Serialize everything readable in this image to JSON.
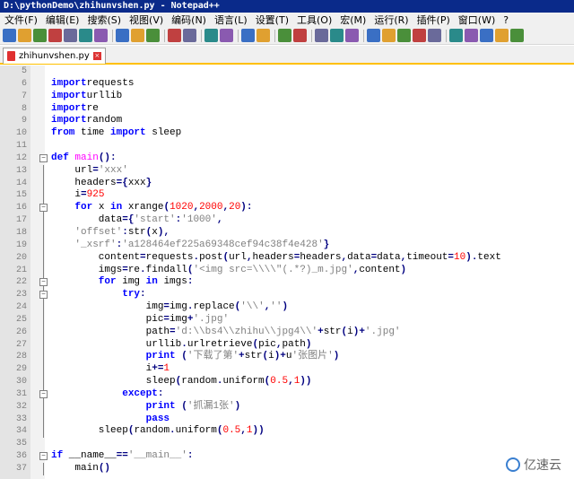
{
  "window": {
    "title": "D:\\pythonDemo\\zhihunvshen.py - Notepad++"
  },
  "menu": [
    "文件(F)",
    "编辑(E)",
    "搜索(S)",
    "视图(V)",
    "编码(N)",
    "语言(L)",
    "设置(T)",
    "工具(O)",
    "宏(M)",
    "运行(R)",
    "插件(P)",
    "窗口(W)",
    "?"
  ],
  "toolbar": {
    "icons": [
      "new-file-icon",
      "open-file-icon",
      "save-icon",
      "save-all-icon",
      "close-icon",
      "close-all-icon",
      "print-icon",
      "sep",
      "cut-icon",
      "copy-icon",
      "paste-icon",
      "sep",
      "undo-icon",
      "redo-icon",
      "sep",
      "find-icon",
      "replace-icon",
      "sep",
      "zoom-in-icon",
      "zoom-out-icon",
      "sep",
      "sync-v-icon",
      "sync-h-icon",
      "sep",
      "wrap-icon",
      "all-chars-icon",
      "indent-guide-icon",
      "sep",
      "lang-icon",
      "doc-map-icon",
      "func-list-icon",
      "folder-icon",
      "monitor-icon",
      "sep",
      "record-icon",
      "stop-icon",
      "play-icon",
      "play-multi-icon",
      "save-macro-icon"
    ]
  },
  "tab": {
    "label": "zhihunvshen.py"
  },
  "editor": {
    "lines": [
      {
        "n": "5",
        "t": []
      },
      {
        "n": "6",
        "t": [
          [
            "kw",
            "import"
          ],
          [
            "",
            "requests"
          ]
        ]
      },
      {
        "n": "7",
        "t": [
          [
            "kw",
            "import"
          ],
          [
            "",
            "urllib"
          ]
        ]
      },
      {
        "n": "8",
        "t": [
          [
            "kw",
            "import"
          ],
          [
            "",
            "re"
          ]
        ]
      },
      {
        "n": "9",
        "t": [
          [
            "kw",
            "import"
          ],
          [
            "",
            "random"
          ]
        ]
      },
      {
        "n": "10",
        "t": [
          [
            "kw",
            "from"
          ],
          [
            "",
            " time "
          ],
          [
            "kw",
            "import"
          ],
          [
            "",
            " sleep"
          ]
        ]
      },
      {
        "n": "11",
        "t": []
      },
      {
        "n": "12",
        "t": [
          [
            "kw",
            "def"
          ],
          [
            "",
            " "
          ],
          [
            "fn",
            "main"
          ],
          [
            "op",
            "():"
          ]
        ]
      },
      {
        "n": "13",
        "t": [
          [
            "",
            "    url"
          ],
          [
            "op",
            "="
          ],
          [
            "str",
            "'xxx'"
          ]
        ]
      },
      {
        "n": "14",
        "t": [
          [
            "",
            "    headers"
          ],
          [
            "op",
            "={"
          ],
          [
            "",
            "xxx"
          ],
          [
            "op",
            "}"
          ]
        ]
      },
      {
        "n": "15",
        "t": [
          [
            "",
            "    i"
          ],
          [
            "op",
            "="
          ],
          [
            "num",
            "925"
          ]
        ]
      },
      {
        "n": "16",
        "t": [
          [
            "kw",
            "    for"
          ],
          [
            "",
            " x "
          ],
          [
            "kw",
            "in"
          ],
          [
            "",
            " xrange"
          ],
          [
            "op",
            "("
          ],
          [
            "num",
            "1020"
          ],
          [
            "op",
            ","
          ],
          [
            "num",
            "2000"
          ],
          [
            "op",
            ","
          ],
          [
            "num",
            "20"
          ],
          [
            "op",
            "):"
          ]
        ]
      },
      {
        "n": "17",
        "t": [
          [
            "",
            "        data"
          ],
          [
            "op",
            "={"
          ],
          [
            "str",
            "'start'"
          ],
          [
            "op",
            ":"
          ],
          [
            "str",
            "'1000'"
          ],
          [
            "op",
            ","
          ]
        ]
      },
      {
        "n": "18",
        "t": [
          [
            "",
            "    "
          ],
          [
            "str",
            "'offset'"
          ],
          [
            "op",
            ":"
          ],
          [
            "",
            "str"
          ],
          [
            "op",
            "("
          ],
          [
            "",
            "x"
          ],
          [
            "op",
            "),"
          ]
        ]
      },
      {
        "n": "19",
        "t": [
          [
            "",
            "    "
          ],
          [
            "str",
            "'_xsrf'"
          ],
          [
            "op",
            ":"
          ],
          [
            "str",
            "'a128464ef225a69348cef94c38f4e428'"
          ],
          [
            "op",
            "}"
          ]
        ]
      },
      {
        "n": "20",
        "t": [
          [
            "",
            "        content"
          ],
          [
            "op",
            "="
          ],
          [
            "",
            "requests"
          ],
          [
            "op",
            "."
          ],
          [
            "",
            "post"
          ],
          [
            "op",
            "("
          ],
          [
            "",
            "url"
          ],
          [
            "op",
            ","
          ],
          [
            "",
            "headers"
          ],
          [
            "op",
            "="
          ],
          [
            "",
            "headers"
          ],
          [
            "op",
            ","
          ],
          [
            "",
            "data"
          ],
          [
            "op",
            "="
          ],
          [
            "",
            "data"
          ],
          [
            "op",
            ","
          ],
          [
            "",
            "timeout"
          ],
          [
            "op",
            "="
          ],
          [
            "num",
            "10"
          ],
          [
            "op",
            ")."
          ],
          [
            "",
            "text"
          ]
        ]
      },
      {
        "n": "21",
        "t": [
          [
            "",
            "        imgs"
          ],
          [
            "op",
            "="
          ],
          [
            "",
            "re"
          ],
          [
            "op",
            "."
          ],
          [
            "",
            "findall"
          ],
          [
            "op",
            "("
          ],
          [
            "str",
            "'<img src=\\\\\\\\\"(.*?)_m.jpg'"
          ],
          [
            "op",
            ","
          ],
          [
            "",
            "content"
          ],
          [
            "op",
            ")"
          ]
        ]
      },
      {
        "n": "22",
        "t": [
          [
            "kw",
            "        for"
          ],
          [
            "",
            " img "
          ],
          [
            "kw",
            "in"
          ],
          [
            "",
            " imgs"
          ],
          [
            "op",
            ":"
          ]
        ]
      },
      {
        "n": "23",
        "t": [
          [
            "kw",
            "            try"
          ],
          [
            "op",
            ":"
          ]
        ]
      },
      {
        "n": "24",
        "t": [
          [
            "",
            "                img"
          ],
          [
            "op",
            "="
          ],
          [
            "",
            "img"
          ],
          [
            "op",
            "."
          ],
          [
            "",
            "replace"
          ],
          [
            "op",
            "("
          ],
          [
            "str",
            "'\\\\'"
          ],
          [
            "op",
            ","
          ],
          [
            "str",
            "''"
          ],
          [
            "op",
            ")"
          ]
        ]
      },
      {
        "n": "25",
        "t": [
          [
            "",
            "                pic"
          ],
          [
            "op",
            "="
          ],
          [
            "",
            "img"
          ],
          [
            "op",
            "+"
          ],
          [
            "str",
            "'.jpg'"
          ]
        ]
      },
      {
        "n": "26",
        "t": [
          [
            "",
            "                path"
          ],
          [
            "op",
            "="
          ],
          [
            "str",
            "'d:\\\\bs4\\\\zhihu\\\\jpg4\\\\'"
          ],
          [
            "op",
            "+"
          ],
          [
            "",
            "str"
          ],
          [
            "op",
            "("
          ],
          [
            "",
            "i"
          ],
          [
            "op",
            ")+"
          ],
          [
            "str",
            "'.jpg'"
          ]
        ]
      },
      {
        "n": "27",
        "t": [
          [
            "",
            "                urllib"
          ],
          [
            "op",
            "."
          ],
          [
            "",
            "urlretrieve"
          ],
          [
            "op",
            "("
          ],
          [
            "",
            "pic"
          ],
          [
            "op",
            ","
          ],
          [
            "",
            "path"
          ],
          [
            "op",
            ")"
          ]
        ]
      },
      {
        "n": "28",
        "t": [
          [
            "kw",
            "                print"
          ],
          [
            "",
            " "
          ],
          [
            "op",
            "("
          ],
          [
            "str",
            "'下载了第'"
          ],
          [
            "op",
            "+"
          ],
          [
            "",
            "str"
          ],
          [
            "op",
            "("
          ],
          [
            "",
            "i"
          ],
          [
            "op",
            ")+"
          ],
          [
            "",
            "u"
          ],
          [
            "str",
            "'张图片'"
          ],
          [
            "op",
            ")"
          ]
        ]
      },
      {
        "n": "29",
        "t": [
          [
            "",
            "                i"
          ],
          [
            "op",
            "+="
          ],
          [
            "num",
            "1"
          ]
        ]
      },
      {
        "n": "30",
        "t": [
          [
            "",
            "                sleep"
          ],
          [
            "op",
            "("
          ],
          [
            "",
            "random"
          ],
          [
            "op",
            "."
          ],
          [
            "",
            "uniform"
          ],
          [
            "op",
            "("
          ],
          [
            "num",
            "0.5"
          ],
          [
            "op",
            ","
          ],
          [
            "num",
            "1"
          ],
          [
            "op",
            "))"
          ]
        ]
      },
      {
        "n": "31",
        "t": [
          [
            "kw",
            "            except"
          ],
          [
            "op",
            ":"
          ]
        ]
      },
      {
        "n": "32",
        "t": [
          [
            "kw",
            "                print"
          ],
          [
            "",
            " "
          ],
          [
            "op",
            "("
          ],
          [
            "str",
            "'抓漏1张'"
          ],
          [
            "op",
            ")"
          ]
        ]
      },
      {
        "n": "33",
        "t": [
          [
            "kw",
            "                pass"
          ]
        ]
      },
      {
        "n": "34",
        "t": [
          [
            "",
            "        sleep"
          ],
          [
            "op",
            "("
          ],
          [
            "",
            "random"
          ],
          [
            "op",
            "."
          ],
          [
            "",
            "uniform"
          ],
          [
            "op",
            "("
          ],
          [
            "num",
            "0.5"
          ],
          [
            "op",
            ","
          ],
          [
            "num",
            "1"
          ],
          [
            "op",
            "))"
          ]
        ]
      },
      {
        "n": "35",
        "t": []
      },
      {
        "n": "36",
        "t": [
          [
            "kw",
            "if"
          ],
          [
            "",
            " __name__"
          ],
          [
            "op",
            "=="
          ],
          [
            "str",
            "'__main__'"
          ],
          [
            "op",
            ":"
          ]
        ]
      },
      {
        "n": "37",
        "t": [
          [
            "",
            "    main"
          ],
          [
            "op",
            "()"
          ]
        ]
      }
    ],
    "fold_markers": {
      "12": "−",
      "16": "−",
      "22": "−",
      "23": "−",
      "31": "−",
      "36": "−"
    },
    "fold_lines": [
      [
        "12",
        "34"
      ],
      [
        "16",
        "34"
      ],
      [
        "22",
        "33"
      ],
      [
        "36",
        "37"
      ]
    ]
  },
  "watermark": {
    "text": "亿速云"
  }
}
